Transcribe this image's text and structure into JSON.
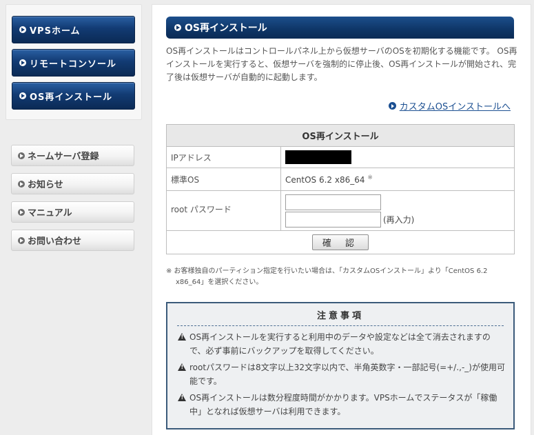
{
  "sidebar": {
    "primary": [
      {
        "label": "VPSホーム"
      },
      {
        "label": "リモートコンソール"
      },
      {
        "label": "OS再インストール"
      }
    ],
    "secondary": [
      {
        "label": "ネームサーバ登録"
      },
      {
        "label": "お知らせ"
      },
      {
        "label": "マニュアル"
      },
      {
        "label": "お問い合わせ"
      }
    ]
  },
  "main": {
    "title": "OS再インストール",
    "intro": "OS再インストールはコントロールパネル上から仮想サーバのOSを初期化する機能です。 OS再インストールを実行すると、仮想サーバを強制的に停止後、OS再インストールが開始され、完了後は仮想サーバが自動的に起動します。",
    "custom_link": "カスタムOSインストールへ",
    "form": {
      "header": "OS再インストール",
      "ip_label": "IPアドレス",
      "os_label": "標準OS",
      "os_value": "CentOS 6.2 x86_64",
      "os_mark": "※",
      "pw_label": "root パスワード",
      "reenter": "(再入力)",
      "confirm": "確 認"
    },
    "note": "※ お客様独自のパーティション指定を行いたい場合は、「カスタムOSインストール」より「CentOS 6.2 x86_64」を選択ください。",
    "caution": {
      "title": "注意事項",
      "items": [
        "OS再インストールを実行すると利用中のデータや設定などは全て消去されますので、必ず事前にバックアップを取得してください。",
        "rootパスワードは8文字以上32文字以内で、半角英数字・一部記号(=+/.,-_)が使用可能です。",
        "OS再インストールは数分程度時間がかかります。VPSホームでステータスが「稼働中」となれば仮想サーバは利用できます。"
      ]
    }
  },
  "colors": {
    "nav_blue": "#123b73",
    "link_blue": "#1b4f91",
    "caution_border": "#3a5a7a"
  }
}
